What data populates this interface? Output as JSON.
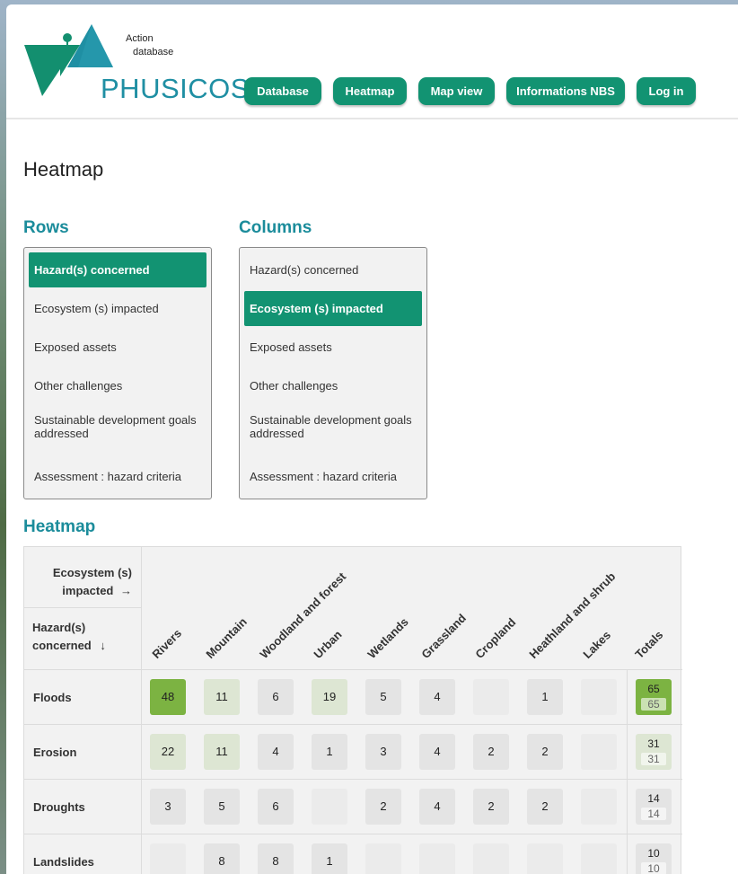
{
  "logo": {
    "name": "PHUSICOS",
    "sub1": "Action",
    "sub2": "database"
  },
  "nav": [
    {
      "label": "Database",
      "name": "nav-database"
    },
    {
      "label": "Heatmap",
      "name": "nav-heatmap"
    },
    {
      "label": "Map view",
      "name": "nav-map-view"
    },
    {
      "label": "Informations NBS",
      "name": "nav-informations-nbs"
    },
    {
      "label": "Log in",
      "name": "nav-log-in"
    }
  ],
  "page_title": "Heatmap",
  "rows_panel": {
    "title": "Rows",
    "options": [
      "Hazard(s) concerned",
      "Ecosystem (s) impacted",
      "Exposed assets",
      "Other challenges",
      "Sustainable development goals addressed",
      "Assessment : hazard criteria"
    ],
    "selected": "Hazard(s) concerned"
  },
  "columns_panel": {
    "title": "Columns",
    "options": [
      "Hazard(s) concerned",
      "Ecosystem (s) impacted",
      "Exposed assets",
      "Other challenges",
      "Sustainable development goals addressed",
      "Assessment : hazard criteria"
    ],
    "selected": "Ecosystem (s) impacted"
  },
  "heatmap": {
    "title": "Heatmap",
    "col_axis_label": "Ecosystem (s) impacted",
    "col_axis_arrow": "→",
    "row_axis_label": "Hazard(s) concerned",
    "row_axis_arrow": "↓",
    "columns": [
      "Rivers",
      "Mountain",
      "Woodland and forest",
      "Urban",
      "Wetlands",
      "Grassland",
      "Cropland",
      "Heathland and shrub",
      "Lakes"
    ],
    "totals_label": "Totals",
    "rows": [
      {
        "label": "Floods",
        "values": [
          48,
          11,
          6,
          19,
          5,
          4,
          null,
          1,
          null
        ],
        "total": 65,
        "total_sub": 65
      },
      {
        "label": "Erosion",
        "values": [
          22,
          11,
          4,
          1,
          3,
          4,
          2,
          2,
          null
        ],
        "total": 31,
        "total_sub": 31
      },
      {
        "label": "Droughts",
        "values": [
          3,
          5,
          6,
          null,
          2,
          4,
          2,
          2,
          null
        ],
        "total": 14,
        "total_sub": 14
      },
      {
        "label": "Landslides",
        "values": [
          null,
          8,
          8,
          1,
          null,
          null,
          null,
          null,
          null
        ],
        "total": 10,
        "total_sub": 10
      }
    ],
    "colors": {
      "high": "#7cb342",
      "mid": "#dde6d3",
      "low": "#e4e4e4",
      "empty": "#ebebeb"
    }
  }
}
